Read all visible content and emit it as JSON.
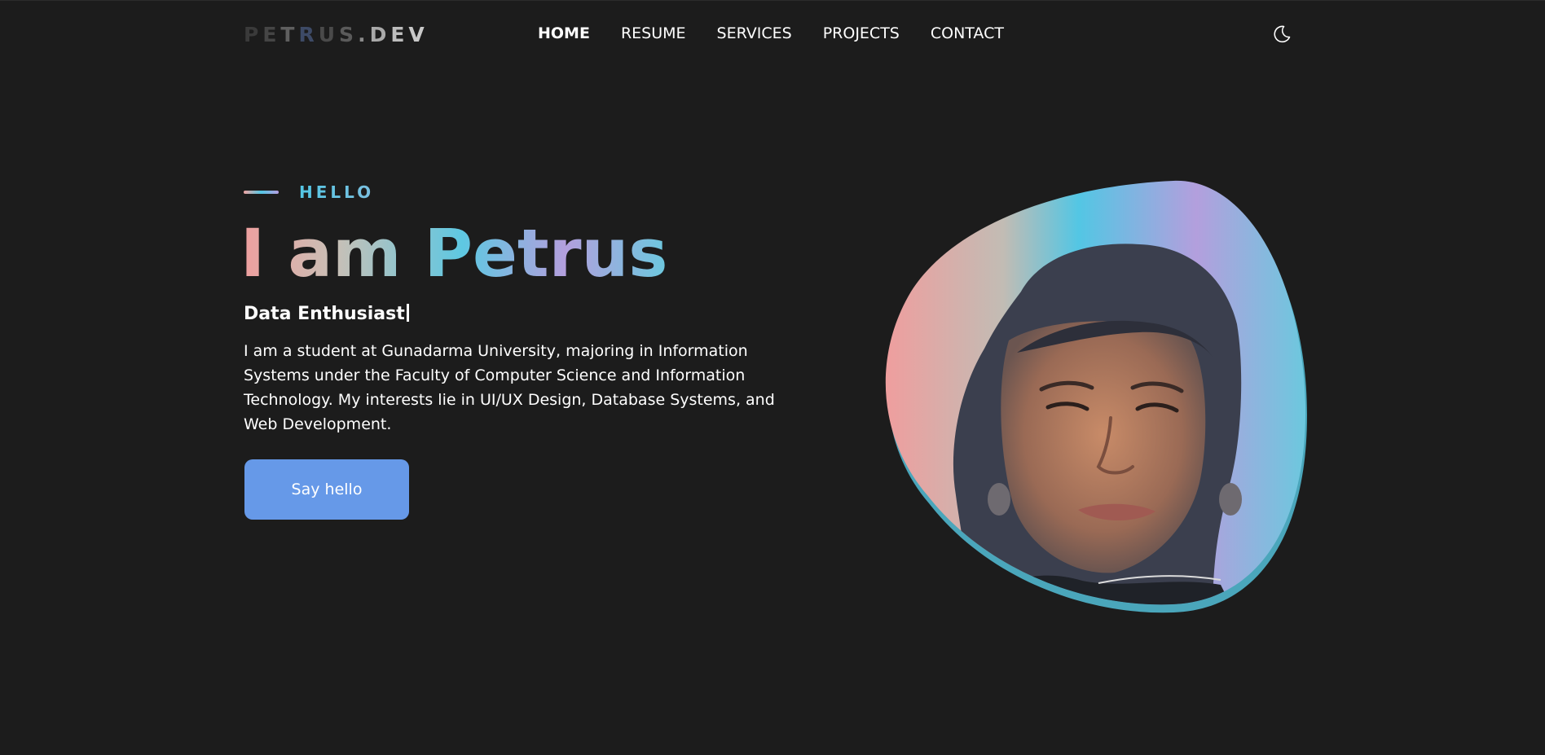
{
  "header": {
    "logo_letters": [
      "P",
      "E",
      "T",
      "R",
      "U",
      "S",
      ".",
      "D",
      "E",
      "V"
    ],
    "nav": [
      {
        "label": "HOME",
        "active": true
      },
      {
        "label": "RESUME",
        "active": false
      },
      {
        "label": "SERVICES",
        "active": false
      },
      {
        "label": "PROJECTS",
        "active": false
      },
      {
        "label": "CONTACT",
        "active": false
      }
    ],
    "theme_toggle_icon": "moon-icon"
  },
  "hero": {
    "eyebrow": "HELLO",
    "title": "I am Petrus",
    "role": "Data Enthusiast",
    "bio": "I am a student at Gunadarma University, majoring in Information Systems under the Faculty of Computer Science and Information Technology. My interests lie in UI/UX Design, Database Systems, and Web Development.",
    "cta_label": "Say hello"
  },
  "colors": {
    "background": "#1c1c1c",
    "accent_blue": "#6699e8",
    "gradient_pink": "#ef9e9e",
    "gradient_cyan": "#53c6e4",
    "gradient_violet": "#b39fdd"
  }
}
